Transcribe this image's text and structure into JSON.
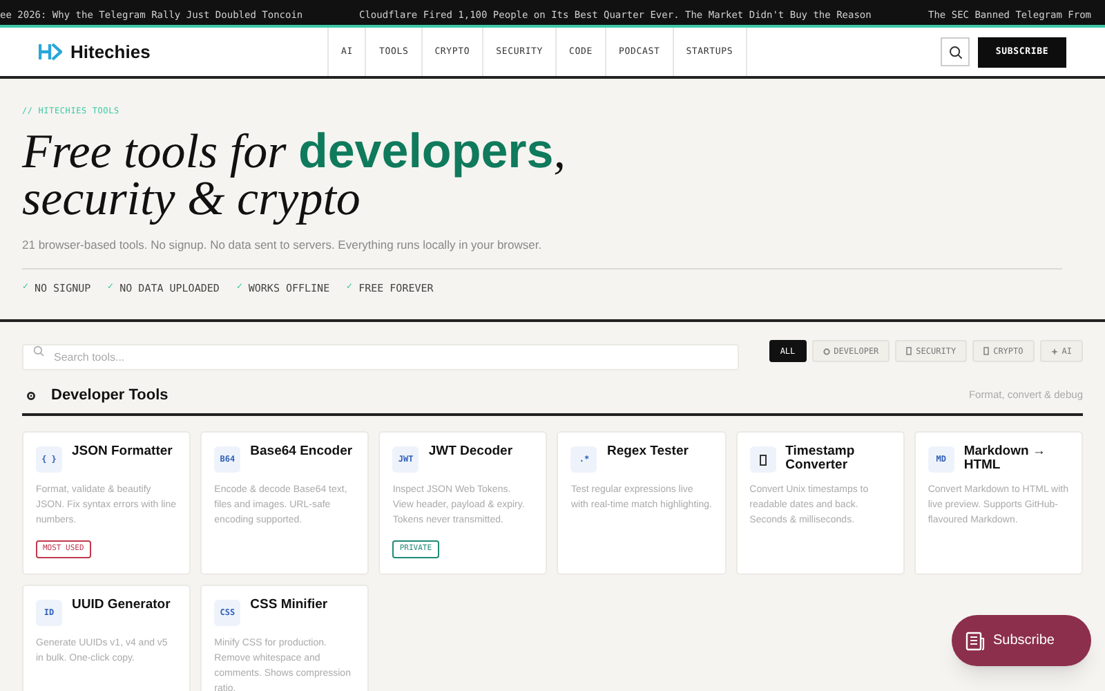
{
  "ticker": [
    "ee 2026: Why the Telegram Rally Just Doubled Toncoin",
    "Cloudflare Fired 1,100 People on Its Best Quarter Ever. The Market Didn't Buy the Reason",
    "The SEC Banned Telegram From"
  ],
  "header": {
    "logo": "Hitechies",
    "nav": [
      "AI",
      "TOOLS",
      "CRYPTO",
      "SECURITY",
      "CODE",
      "PODCAST",
      "STARTUPS"
    ],
    "subscribe": "SUBSCRIBE"
  },
  "hero": {
    "eyebrow": "// HITECHIES TOOLS",
    "title_start": "Free tools for ",
    "title_accent": "developers",
    "title_comma": ",",
    "title_line2": "security & crypto",
    "subtitle": "21 browser-based tools. No signup. No data sent to servers. Everything runs locally in your browser.",
    "features": [
      "NO SIGNUP",
      "NO DATA UPLOADED",
      "WORKS OFFLINE",
      "FREE FOREVER"
    ],
    "check": "✓"
  },
  "search": {
    "placeholder": "Search tools..."
  },
  "filters": [
    {
      "label": "ALL",
      "kind": "plain",
      "selected": true
    },
    {
      "label": "DEVELOPER",
      "kind": "developer",
      "selected": false
    },
    {
      "label": "SECURITY",
      "kind": "security",
      "selected": false
    },
    {
      "label": "CRYPTO",
      "kind": "crypto",
      "selected": false
    },
    {
      "label": "AI",
      "kind": "ai",
      "selected": false
    }
  ],
  "section": {
    "title": "Developer Tools",
    "note": "Format, convert & debug"
  },
  "tools": [
    {
      "icon_text": "{ }",
      "name": "JSON Formatter",
      "description": "Format, validate & beautify JSON. Fix syntax errors with line numbers.",
      "badge": {
        "text": "MOST USED",
        "color": "#c0394f"
      }
    },
    {
      "icon_text": "B64",
      "name": "Base64 Encoder",
      "description": "Encode & decode Base64 text, files and images. URL-safe encoding supported."
    },
    {
      "icon_text": "JWT",
      "name": "JWT Decoder",
      "description": "Inspect JSON Web Tokens. View header, payload & expiry. Tokens never transmitted.",
      "badge": {
        "text": "PRIVATE",
        "color": "#1f8a78"
      }
    },
    {
      "icon_text": ".*",
      "name": "Regex Tester",
      "description": "Test regular expressions live with real-time match highlighting."
    },
    {
      "name": "Timestamp Converter",
      "description": "Convert Unix timestamps to readable dates and back. Seconds & milliseconds."
    },
    {
      "icon_text": "MD",
      "name": "Markdown → HTML",
      "description": "Convert Markdown to HTML with live preview. Supports GitHub-flavoured Markdown."
    },
    {
      "icon_text": "ID",
      "name": "UUID Generator",
      "description": "Generate UUIDs v1, v4 and v5 in bulk. One-click copy."
    },
    {
      "icon_text": "CSS",
      "name": "CSS Minifier",
      "description": "Minify CSS for production. Remove whitespace and comments. Shows compression ratio."
    }
  ],
  "floating_button": {
    "label": "Subscribe"
  }
}
